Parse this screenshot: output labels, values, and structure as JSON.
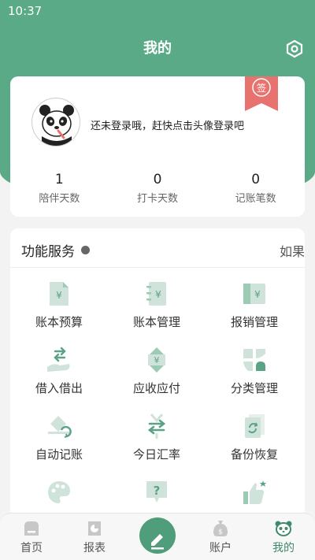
{
  "status_bar": {
    "time": "10:37"
  },
  "header": {
    "title": "我的"
  },
  "profile": {
    "login_prompt": "还未登录哦，赶快点击头像登录吧",
    "sign_badge": "签"
  },
  "stats": [
    {
      "value": "1",
      "label": "陪伴天数"
    },
    {
      "value": "0",
      "label": "打卡天数"
    },
    {
      "value": "0",
      "label": "记账笔数"
    }
  ],
  "services": {
    "title": "功能服务",
    "more": "如果",
    "items": [
      {
        "label": "账本预算",
        "icon": "budget-icon"
      },
      {
        "label": "账本管理",
        "icon": "ledger-icon"
      },
      {
        "label": "报销管理",
        "icon": "reimburse-icon"
      },
      {
        "label": "借入借出",
        "icon": "lend-icon"
      },
      {
        "label": "应收应付",
        "icon": "receivable-icon"
      },
      {
        "label": "分类管理",
        "icon": "category-icon"
      },
      {
        "label": "自动记账",
        "icon": "auto-record-icon"
      },
      {
        "label": "今日汇率",
        "icon": "exchange-rate-icon"
      },
      {
        "label": "备份恢复",
        "icon": "backup-icon"
      },
      {
        "label": "",
        "icon": "palette-icon"
      },
      {
        "label": "",
        "icon": "help-icon"
      },
      {
        "label": "",
        "icon": "thumbs-up-icon"
      }
    ]
  },
  "tabbar": {
    "tabs": [
      {
        "label": "首页",
        "icon": "home-icon"
      },
      {
        "label": "报表",
        "icon": "report-icon"
      },
      {
        "label": "",
        "icon": "edit-icon"
      },
      {
        "label": "账户",
        "icon": "wallet-icon"
      },
      {
        "label": "我的",
        "icon": "panda-icon",
        "active": true
      }
    ]
  },
  "colors": {
    "accent": "#5aaa88",
    "icon_fill": "#cfe3da",
    "icon_dark": "#5aa386",
    "badge": "#e8736e"
  }
}
